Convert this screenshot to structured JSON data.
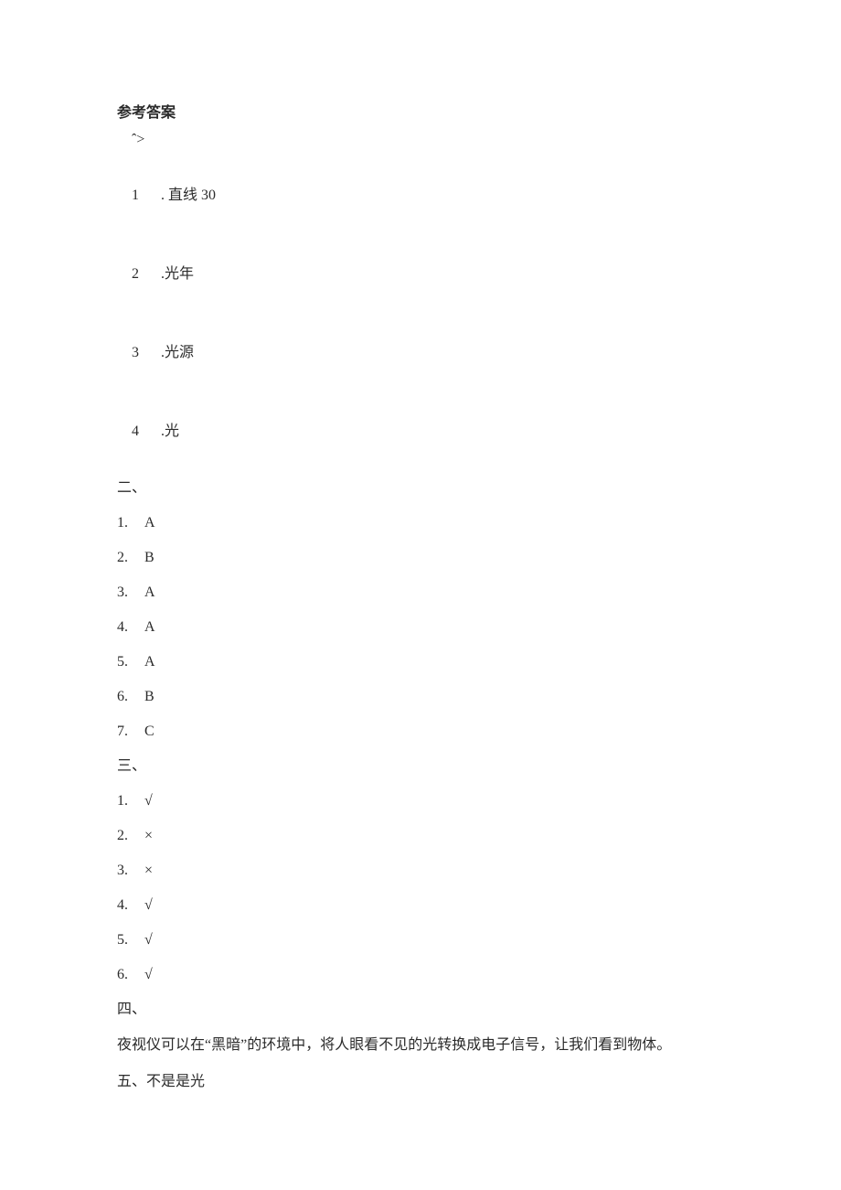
{
  "title": "参考答案",
  "section1": {
    "mark": "ˆ>",
    "items": [
      {
        "num": "1",
        "dot": ".",
        "text": "直线 30"
      },
      {
        "num": "2",
        "dot": ".",
        "text": "光年"
      },
      {
        "num": "3",
        "dot": ".",
        "text": "光源"
      },
      {
        "num": "4",
        "dot": ".",
        "text": "光"
      }
    ]
  },
  "section2": {
    "label": "二、",
    "items": [
      {
        "num": "1.",
        "ans": "A"
      },
      {
        "num": "2.",
        "ans": "B"
      },
      {
        "num": "3.",
        "ans": "A"
      },
      {
        "num": "4.",
        "ans": "A"
      },
      {
        "num": "5.",
        "ans": "A"
      },
      {
        "num": "6.",
        "ans": "B"
      },
      {
        "num": "7.",
        "ans": "C"
      }
    ]
  },
  "section3": {
    "label": "三、",
    "items": [
      {
        "num": "1.",
        "ans": "√"
      },
      {
        "num": "2.",
        "ans": "×"
      },
      {
        "num": "3.",
        "ans": "×"
      },
      {
        "num": "4.",
        "ans": "√"
      },
      {
        "num": "5.",
        "ans": "√"
      },
      {
        "num": "6.",
        "ans": "√"
      }
    ]
  },
  "section4": {
    "label": "四、",
    "text": "夜视仪可以在“黑暗”的环境中，将人眼看不见的光转换成电子信号，让我们看到物体。"
  },
  "section5": {
    "text": "五、不是是光"
  }
}
